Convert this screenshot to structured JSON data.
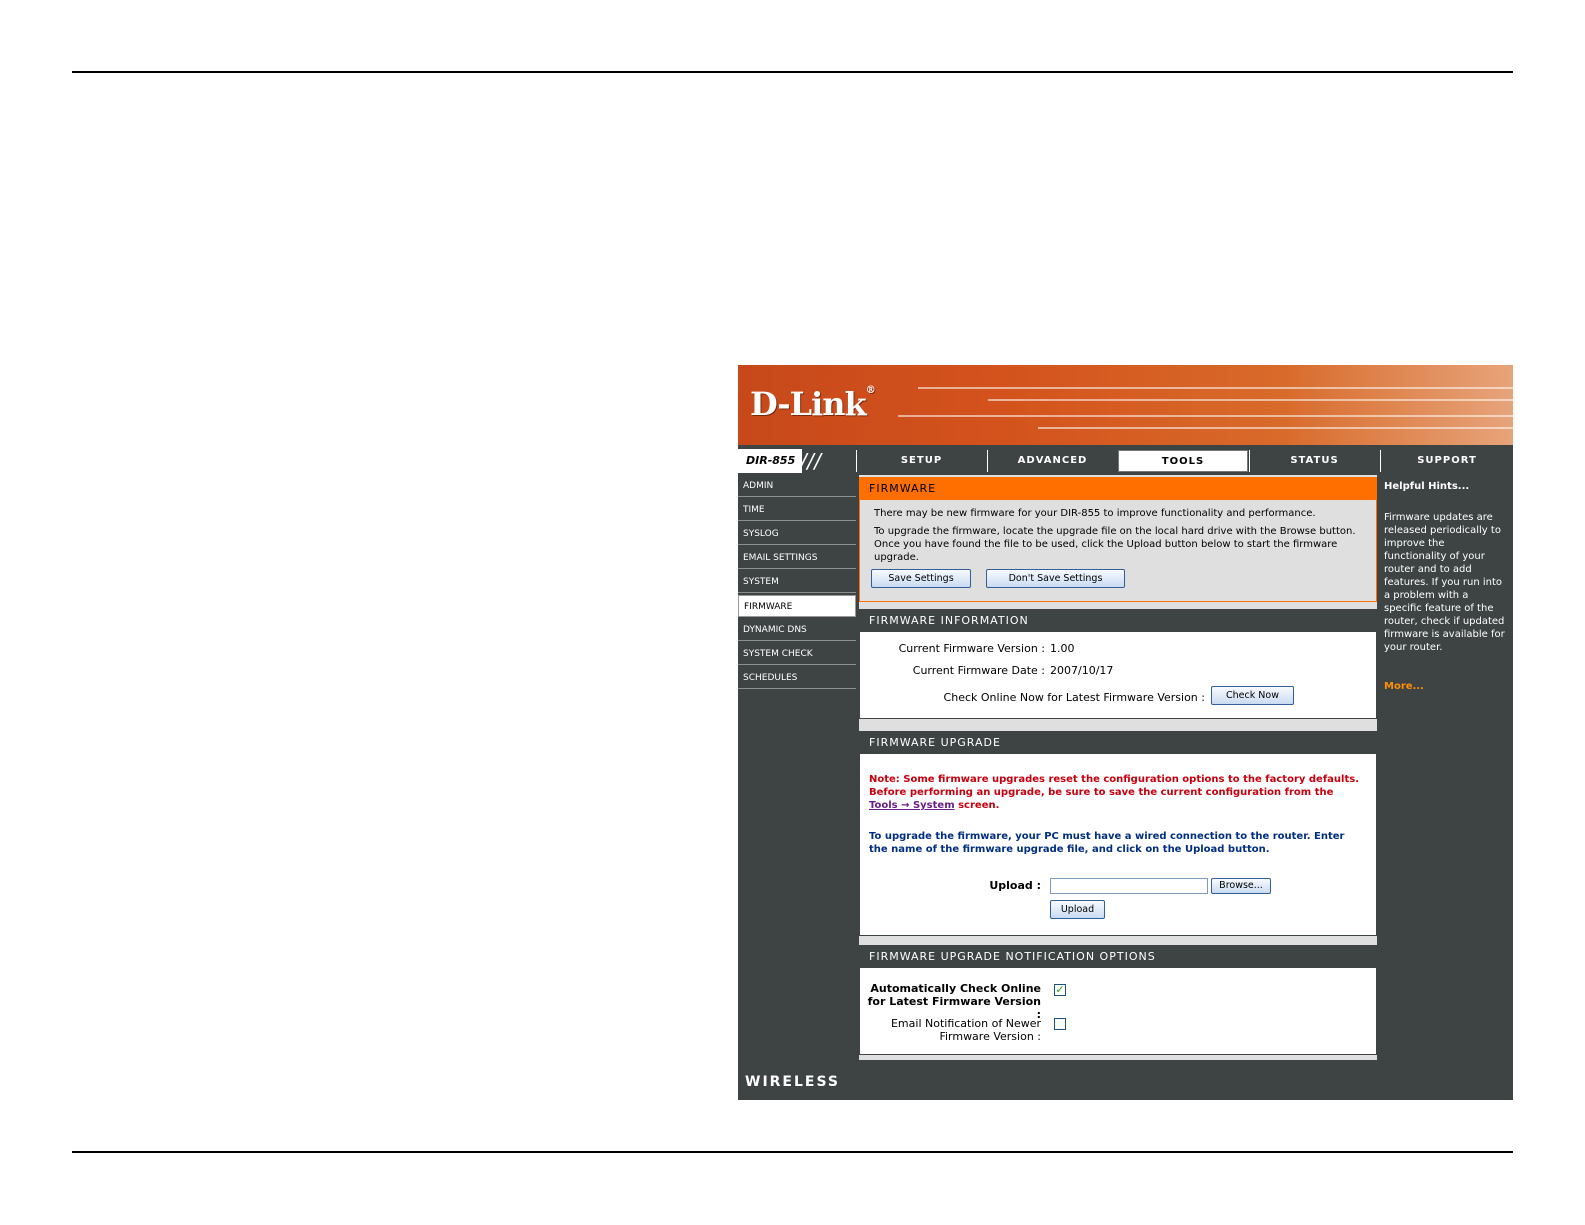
{
  "banner": {
    "logo": "D-Link",
    "logo_mark": "®"
  },
  "model": "DIR-855",
  "nav": {
    "tabs": [
      "SETUP",
      "ADVANCED",
      "TOOLS",
      "STATUS",
      "SUPPORT"
    ],
    "active": "TOOLS"
  },
  "sidebar": {
    "items": [
      "ADMIN",
      "TIME",
      "SYSLOG",
      "EMAIL SETTINGS",
      "SYSTEM",
      "FIRMWARE",
      "DYNAMIC DNS",
      "SYSTEM CHECK",
      "SCHEDULES"
    ],
    "active": "FIRMWARE"
  },
  "firmware": {
    "title": "FIRMWARE",
    "intro": "There may be new firmware for your DIR-855 to improve functionality and performance.",
    "instructions": "To upgrade the firmware, locate the upgrade file on the local hard drive with the Browse button. Once you have found the file to be used, click the Upload button below to start the firmware upgrade.",
    "save_label": "Save Settings",
    "dont_save_label": "Don't Save Settings"
  },
  "info": {
    "title": "FIRMWARE INFORMATION",
    "version_label": "Current Firmware Version :",
    "version_value": "1.00",
    "date_label": "Current Firmware Date :",
    "date_value": "2007/10/17",
    "check_label": "Check Online Now for Latest Firmware Version :",
    "check_button": "Check Now"
  },
  "upgrade": {
    "title": "FIRMWARE UPGRADE",
    "note_prefix": "Note: Some firmware upgrades reset the configuration options to the factory defaults. Before performing an upgrade, be sure to save the current configuration from the",
    "note_link": "Tools → System",
    "note_suffix": "screen.",
    "instructions": "To upgrade the firmware, your PC must have a wired connection to the router. Enter the name of the firmware upgrade file, and click on the Upload button.",
    "upload_label": "Upload :",
    "upload_value": "",
    "browse_label": "Browse...",
    "upload_button": "Upload"
  },
  "notify": {
    "title": "FIRMWARE UPGRADE NOTIFICATION OPTIONS",
    "auto_label_1": "Automatically Check Online",
    "auto_label_2": "for Latest Firmware Version :",
    "auto_checked": true,
    "email_label_1": "Email Notification of Newer",
    "email_label_2": "Firmware Version :",
    "email_checked": false
  },
  "hints": {
    "title": "Helpful Hints...",
    "body": "Firmware updates are released periodically to improve the functionality of your router and to add features. If you run into a problem with a specific feature of the router, check if updated firmware is available for your router.",
    "more": "More..."
  },
  "footer": {
    "brand": "WIRELESS"
  }
}
